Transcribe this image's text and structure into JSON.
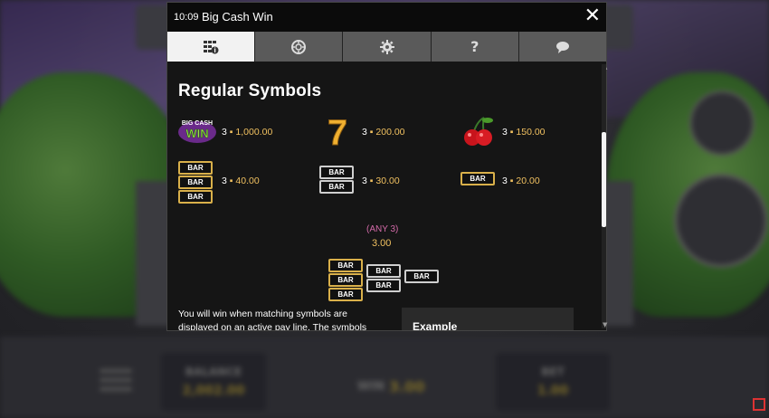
{
  "modal": {
    "time": "10:09",
    "title": "Big Cash Win",
    "close_label": "✕",
    "tabs": [
      {
        "icon": "paytable-icon",
        "active": true
      },
      {
        "icon": "chip-icon",
        "active": false
      },
      {
        "icon": "gear-icon",
        "active": false
      },
      {
        "icon": "question-icon",
        "label": "?",
        "active": false
      },
      {
        "icon": "chat-icon",
        "active": false
      }
    ]
  },
  "paytable": {
    "heading": "Regular Symbols",
    "logo_text": [
      "BIG CASH",
      "WIN"
    ],
    "seven_glyph": "7",
    "bar_label": "BAR",
    "symbols": [
      {
        "name": "big-cash-win",
        "count": "3",
        "payout": "1,000.00"
      },
      {
        "name": "seven",
        "count": "3",
        "payout": "200.00"
      },
      {
        "name": "cherries",
        "count": "3",
        "payout": "150.00"
      },
      {
        "name": "triple-bar",
        "count": "3",
        "payout": "40.00"
      },
      {
        "name": "double-bar",
        "count": "3",
        "payout": "30.00"
      },
      {
        "name": "single-bar",
        "count": "3",
        "payout": "20.00"
      }
    ],
    "any3_label": "(ANY 3)",
    "any3_value": "3.00",
    "description": "You will win when matching symbols are displayed on an active pay line. The symbols",
    "example_label": "Example"
  },
  "game": {
    "balance_label": "BALANCE",
    "balance_value": "2,002.00",
    "win_label": "WIN",
    "win_value": "3.00",
    "bet_label": "BET",
    "bet_value": "1.00"
  },
  "colors": {
    "payout": "#f0c060",
    "any3": "#d36aa8",
    "active_tab": "#f2f2f2"
  }
}
